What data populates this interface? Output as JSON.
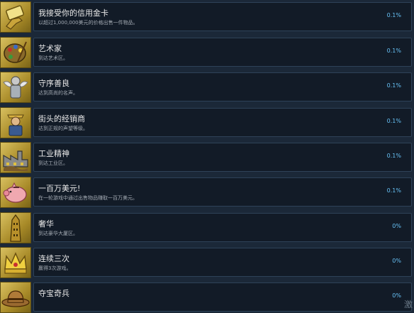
{
  "achievements": [
    {
      "title": "我接受你的信用金卡",
      "desc": "以超过1,000,000美元的价格出售一件物品。",
      "pct": "0.1%",
      "icon": "credit-card-hand-icon"
    },
    {
      "title": "艺术家",
      "desc": "到达艺术区。",
      "pct": "0.1%",
      "icon": "paint-palette-icon"
    },
    {
      "title": "守序善良",
      "desc": "达到高尚的名声。",
      "pct": "0.1%",
      "icon": "angel-knight-icon"
    },
    {
      "title": "街头的经销商",
      "desc": "达到正规的声望等级。",
      "pct": "0.1%",
      "icon": "street-dealer-icon"
    },
    {
      "title": "工业精神",
      "desc": "到达工业区。",
      "pct": "0.1%",
      "icon": "factory-icon"
    },
    {
      "title": "一百万美元!",
      "desc": "在一轮游戏中通过出售物品赚取一百万美元。",
      "pct": "0.1%",
      "icon": "piggy-bank-icon"
    },
    {
      "title": "奢华",
      "desc": "到达豪华大厦区。",
      "pct": "0%",
      "icon": "luxury-tower-icon"
    },
    {
      "title": "连续三次",
      "desc": "赢得3次游戏。",
      "pct": "0%",
      "icon": "crown-icon"
    },
    {
      "title": "夺宝奇兵",
      "desc": "",
      "pct": "0%",
      "icon": "explorer-hat-icon"
    }
  ],
  "corner_text": "激"
}
